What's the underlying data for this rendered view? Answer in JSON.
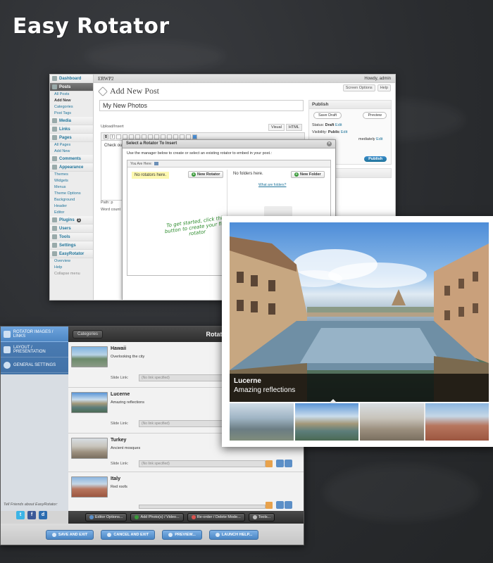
{
  "brand": {
    "title": "Easy Rotator"
  },
  "wp": {
    "site_name": "ERWP2",
    "howdy": "Howdy, admin",
    "page_title": "Add New Post",
    "screen_options": "Screen Options",
    "help": "Help",
    "post_title": "My New Photos",
    "upload_insert": "Upload/Insert",
    "tab_visual": "Visual",
    "tab_html": "HTML",
    "editor_text": "Check ou",
    "path": "Path: p",
    "word_count": "Word count",
    "sidebar": {
      "dashboard": "Dashboard",
      "posts": "Posts",
      "posts_sub": [
        "All Posts",
        "Add New",
        "Categories",
        "Post Tags"
      ],
      "media": "Media",
      "links": "Links",
      "pages": "Pages",
      "pages_sub": [
        "All Pages",
        "Add New"
      ],
      "comments": "Comments",
      "appearance": "Appearance",
      "appearance_sub": [
        "Themes",
        "Widgets",
        "Menus",
        "Theme Options",
        "Background",
        "Header",
        "Editor"
      ],
      "plugins": "Plugins",
      "plugins_badge": "1",
      "users": "Users",
      "tools": "Tools",
      "settings": "Settings",
      "easyrotator": "EasyRotator",
      "easyrotator_sub": [
        "Overview",
        "Help"
      ],
      "collapse": "Collapse menu"
    },
    "publish": {
      "title": "Publish",
      "save_draft": "Save Draft",
      "preview": "Preview",
      "status_label": "Status:",
      "status_value": "Draft",
      "visibility_label": "Visibility:",
      "visibility_value": "Public",
      "immediately": "mediately",
      "edit": "Edit",
      "publish_btn": "Publish"
    },
    "modal": {
      "title": "Select a Rotator To Insert",
      "intro": "Use the manager below to create or select an existing rotator to embed in your post.:",
      "you_are_here": "You Are Here:",
      "no_rotators": "No rotators here.",
      "new_rotator": "New Rotator",
      "no_folders": "No folders here.",
      "new_folder": "New Folder",
      "what_are_folders": "What are folders?",
      "hint": "To get started, click this button to create your first rotator"
    }
  },
  "editor": {
    "nav": [
      "ROTATOR IMAGES / LINKS",
      "LAYOUT / PRESENTATION",
      "GENERAL SETTINGS"
    ],
    "categories": "Categories",
    "title": "Rotator Photos: Main Category",
    "slide_link_label": "Slide Link:",
    "slide_link_placeholder": "(No link specified)",
    "items": [
      {
        "name": "Hawaii",
        "desc": "Overlooking the city"
      },
      {
        "name": "Lucerne",
        "desc": "Amazing reflections"
      },
      {
        "name": "Turkey",
        "desc": "Ancient mosques"
      },
      {
        "name": "Italy",
        "desc": "Red roofs"
      }
    ],
    "tell_friends": "Tell Friends about EasyRotator:",
    "toolbar": [
      "Editor Options...",
      "Add Photo(s) / Video...",
      "Re-order / Delete Mode...",
      "Tools..."
    ],
    "bottom": [
      "SAVE AND EXIT",
      "CANCEL AND EXIT",
      "PREVIEW...",
      "LAUNCH HELP..."
    ]
  },
  "showcase": {
    "caption_title": "Lucerne",
    "caption_desc": "Amazing reflections"
  },
  "colors": {
    "wp_link": "#21759b",
    "editor_blue": "#4a86c4",
    "caption_bg": "#000000"
  }
}
